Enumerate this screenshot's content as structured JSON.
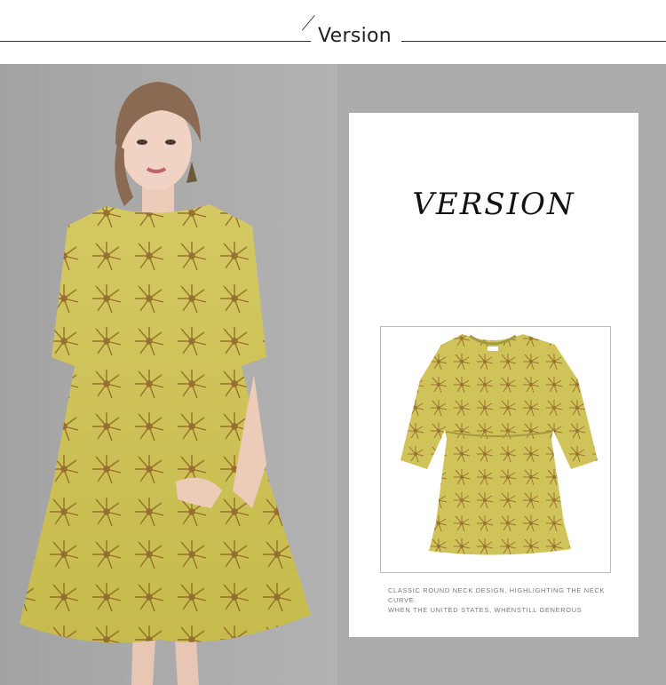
{
  "header": {
    "title": "Version"
  },
  "card": {
    "title": "VERSION",
    "caption_line1": "CLASSIC ROUND NECK DESIGN, HIGHLIGHTING THE NECK CURVE",
    "caption_line2": "WHEN THE UNITED STATES, WHENSTILL GENEROUS"
  },
  "colors": {
    "panel_background": "#ababab",
    "dress_yellow": "#cfc35a",
    "print_brown": "#8a5a23"
  }
}
